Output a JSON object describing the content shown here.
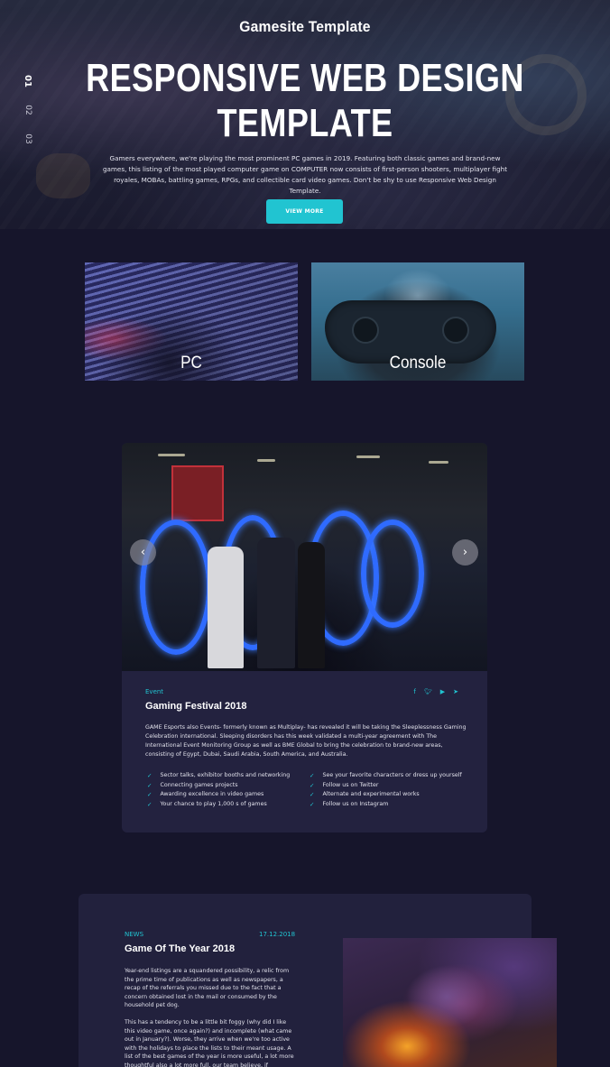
{
  "hero": {
    "site_title": "Gamesite Template",
    "heading_line1": "RESPONSIVE WEB DESIGN",
    "heading_line2": "TEMPLATE",
    "description": "Gamers everywhere, we're playing the most prominent PC games in 2019. Featuring both classic games and brand-new games, this listing of the most played computer game on COMPUTER now consists of first-person shooters, multiplayer fight royales, MOBAs, battling games, RPGs, and collectible card video games. Don't be shy to use Responsive Web Design Template.",
    "button_label": "VIEW MORE",
    "slide_numbers": [
      "01",
      "02",
      "03"
    ]
  },
  "categories": [
    {
      "label": "PC"
    },
    {
      "label": "Console"
    }
  ],
  "event": {
    "category": "Event",
    "title": "Gaming Festival 2018",
    "social_icons": [
      "facebook-icon",
      "twitter-icon",
      "youtube-icon",
      "telegram-icon"
    ],
    "description": "GAME Esports also Events- formerly known as Multiplay- has revealed it will be taking the Sleeplessness Gaming Celebration international. Sleeping disorders has this week validated a multi-year agreement with The International Event Monitoring Group as well as BME Global to bring the celebration to brand-new areas, consisting of Egypt, Dubai, Saudi Arabia, South America, and Australia.",
    "list_left": [
      "Sector talks, exhibitor booths and networking",
      "Connecting games projects",
      "Awarding excellence in video games",
      "Your chance to play 1,000 s of games"
    ],
    "list_right": [
      "See your favorite characters or dress up yourself",
      "Follow us on Twitter",
      "Alternate and experimental works",
      "Follow us on Instagram"
    ],
    "prev_symbol": "‹",
    "next_symbol": "›"
  },
  "news": {
    "category": "NEWS",
    "date": "17.12.2018",
    "title": "Game Of The Year 2018",
    "paragraph1": "Year-end listings are a squandered possibility, a relic from the prime time of publications as well as newspapers, a recap of the referrals you missed due to the fact that a concern obtained lost in the mail or consumed by the household pet dog.",
    "paragraph2": "This has a tendency to be a little bit foggy (why did I like this video game, once again?) and incomplete (what came out in January?). Worse, they arrive when we're too active with the holidays to place the lists to their meant usage. A list of the best games of the year is more useful, a lot more thoughtful also a lot more full, our team believe, if"
  },
  "colors": {
    "accent": "#21c4d1",
    "background": "#16152b",
    "card": "#23223f"
  }
}
